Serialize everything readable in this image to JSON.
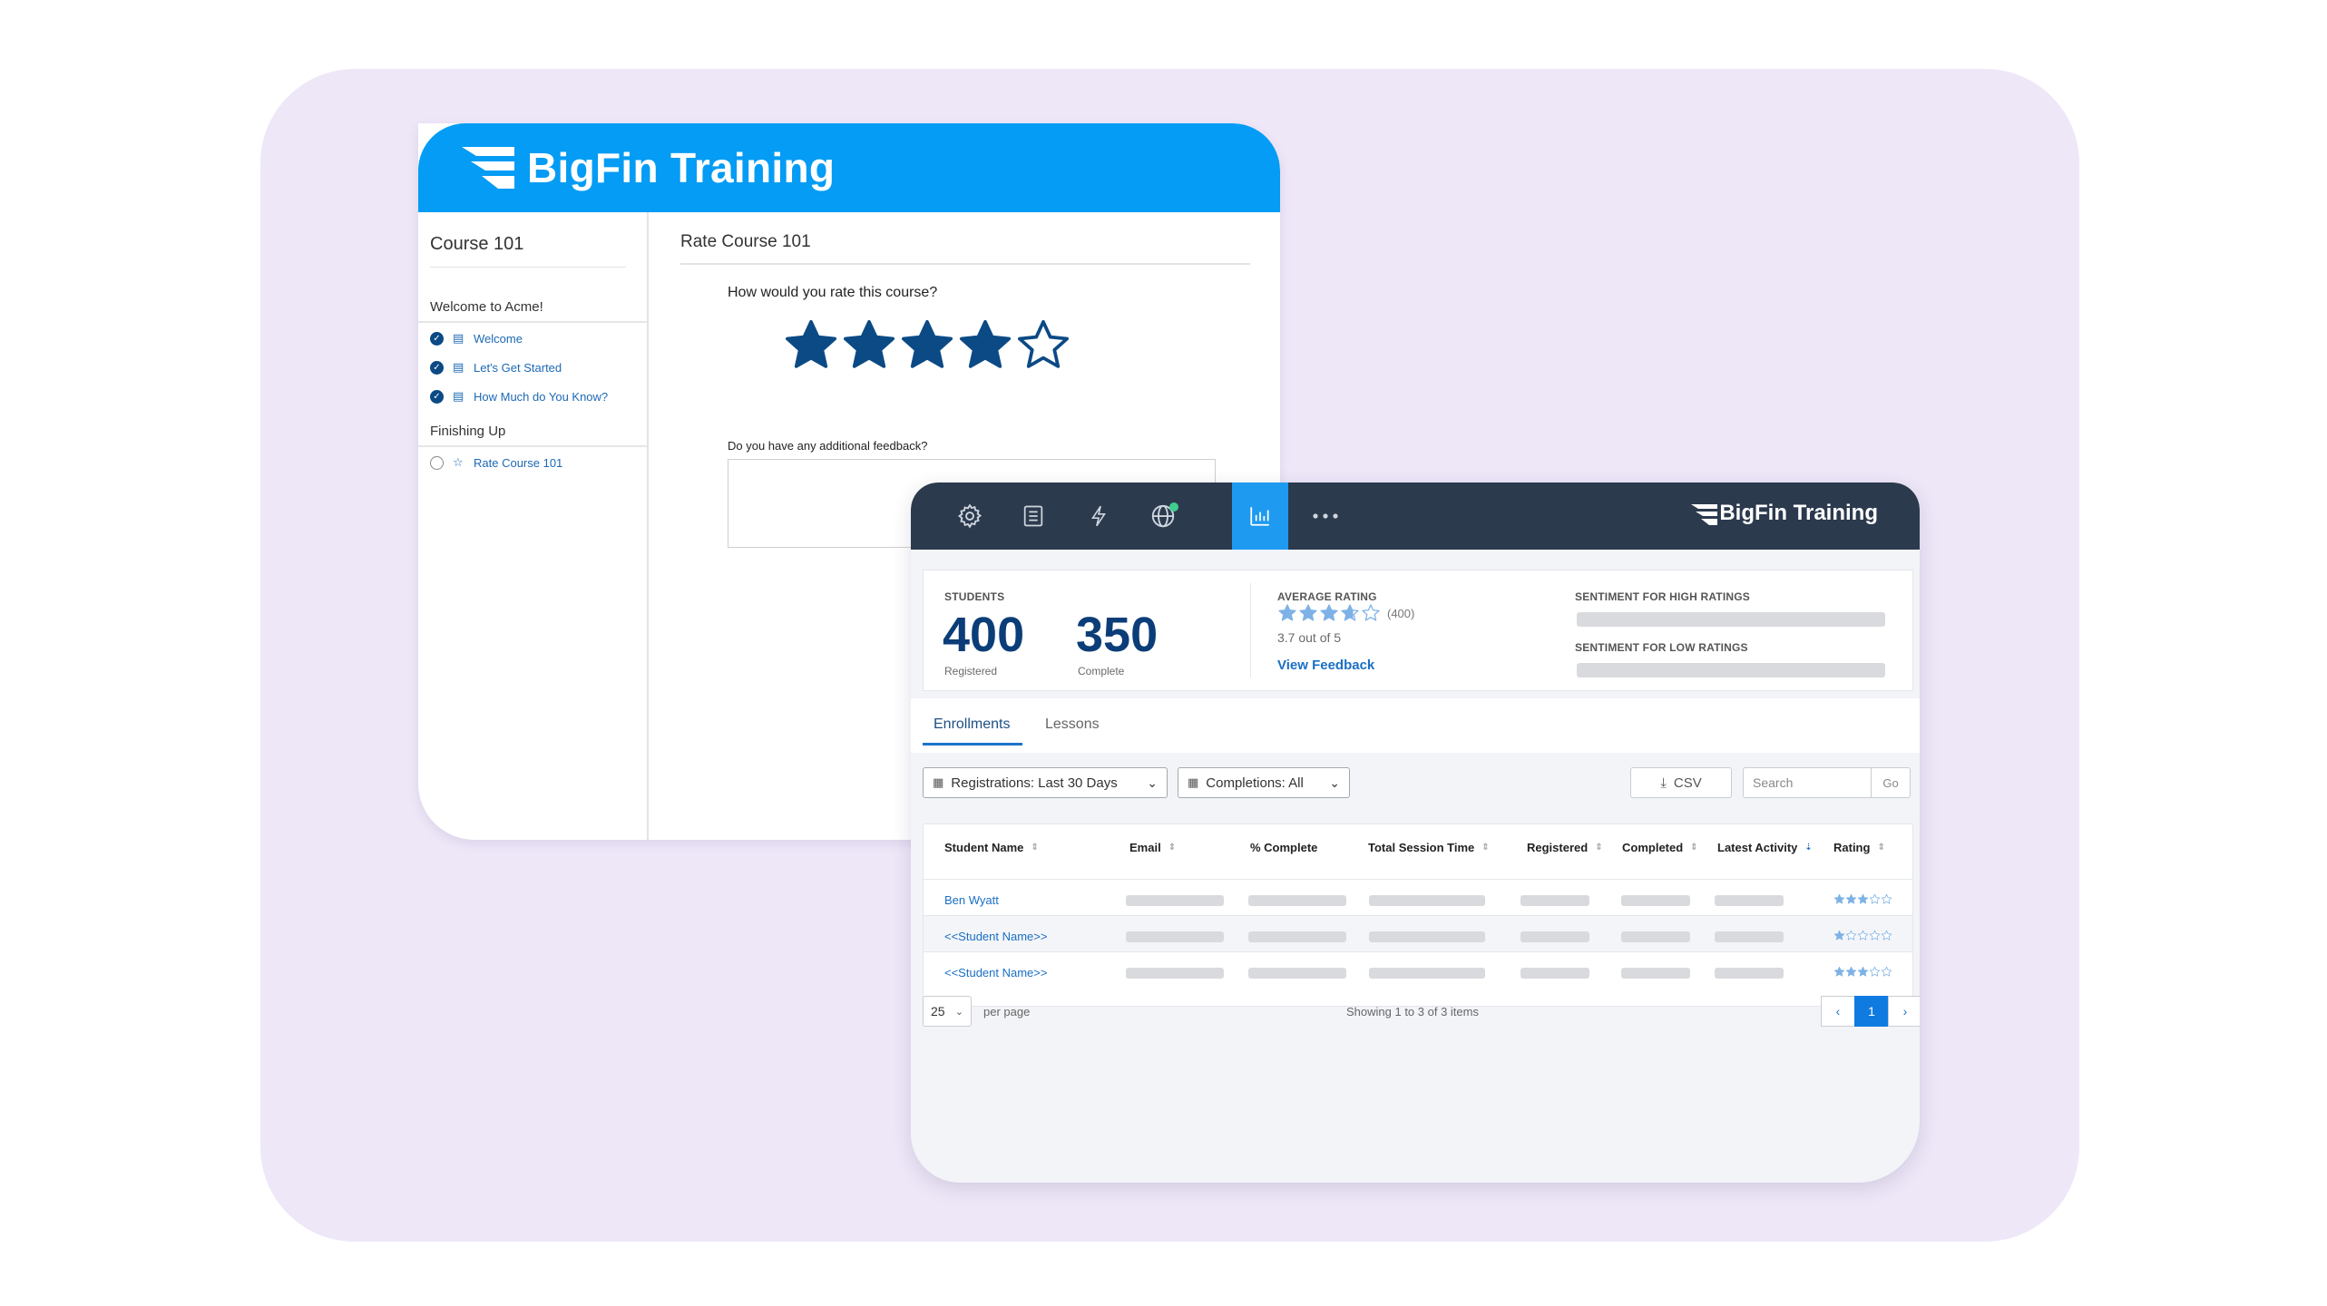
{
  "learner": {
    "brand": "BigFin Training",
    "course_title": "Course 101",
    "sections": [
      {
        "title": "Welcome to Acme!",
        "lessons": [
          "Welcome",
          "Let's Get Started",
          "How Much do You Know?"
        ]
      },
      {
        "title": "Finishing Up",
        "lessons": [
          "Rate Course 101"
        ]
      }
    ],
    "page_title": "Rate Course 101",
    "question": "How would you rate this course?",
    "selected_rating": 4,
    "max_rating": 5,
    "feedback_question": "Do you have any additional feedback?",
    "feedback_value": ""
  },
  "admin": {
    "brand": "BigFin Training",
    "toolbar_icons": [
      "gear-icon",
      "book-icon",
      "lightning-icon",
      "globe-icon",
      "bar-chart-icon",
      "more-icon"
    ],
    "active_icon": "bar-chart-icon",
    "stats": {
      "students_label": "STUDENTS",
      "registered_value": "400",
      "registered_label": "Registered",
      "complete_value": "350",
      "complete_label": "Complete",
      "avg_label": "AVERAGE RATING",
      "avg_rating": 3.7,
      "avg_count": "(400)",
      "avg_text": "3.7 out of 5",
      "view_feedback": "View Feedback",
      "sentiment_high": "SENTIMENT FOR HIGH RATINGS",
      "sentiment_low": "SENTIMENT FOR LOW RATINGS"
    },
    "tabs": [
      "Enrollments",
      "Lessons"
    ],
    "active_tab": "Enrollments",
    "filters": {
      "registrations": "Registrations: Last 30 Days",
      "completions": "Completions: All",
      "csv": "CSV",
      "search_placeholder": "Search",
      "go": "Go"
    },
    "table": {
      "columns": [
        "Student Name",
        "Email",
        "% Complete",
        "Total Session Time",
        "Registered",
        "Completed",
        "Latest Activity",
        "Rating"
      ],
      "rows": [
        {
          "name": "Ben Wyatt",
          "rating": 3
        },
        {
          "name": "<<Student Name>>",
          "rating": 1
        },
        {
          "name": "<<Student Name>>",
          "rating": 3
        }
      ]
    },
    "footer": {
      "per_page_value": "25",
      "per_page_label": "per page",
      "showing": "Showing 1 to 3 of 3 items",
      "current_page": "1"
    }
  },
  "colors": {
    "brand_blue": "#049cf4",
    "navy": "#0b3d78",
    "topbar": "#2c3a4e",
    "accent": "#1e9af0",
    "star_fill_dark": "#0b4a85",
    "star_fill_light": "#7eb2e6"
  }
}
